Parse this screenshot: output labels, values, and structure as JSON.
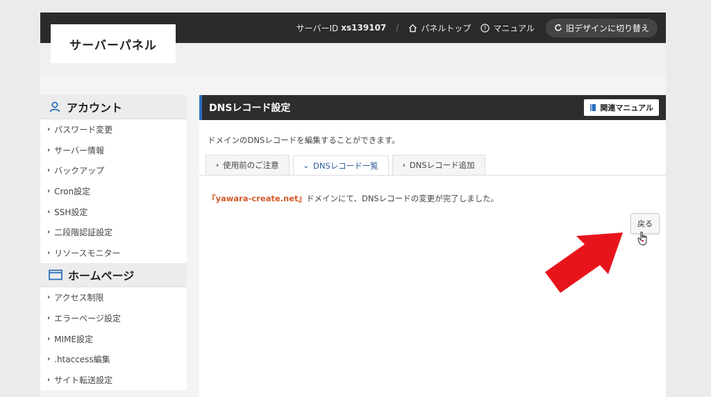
{
  "header": {
    "logo": "サーバーパネル",
    "server_id_label": "サーバーID",
    "server_id": "xs139107",
    "separator": "/",
    "panel_top": "パネルトップ",
    "manual": "マニュアル",
    "old_design": "旧デザインに切り替え"
  },
  "sidebar": {
    "sections": [
      {
        "title": "アカウント",
        "icon": "user-icon",
        "items": [
          "パスワード変更",
          "サーバー情報",
          "バックアップ",
          "Cron設定",
          "SSH設定",
          "二段階認証設定",
          "リソースモニター"
        ]
      },
      {
        "title": "ホームページ",
        "icon": "window-icon",
        "items": [
          "アクセス制限",
          "エラーページ設定",
          "MIME設定",
          ".htaccess編集",
          "サイト転送設定"
        ]
      }
    ]
  },
  "main": {
    "title": "DNSレコード設定",
    "related_manual": "関連マニュアル",
    "description": "ドメインのDNSレコードを編集することができます。",
    "tabs": [
      {
        "label": "使用前のご注意",
        "active": false
      },
      {
        "label": "DNSレコード一覧",
        "active": true
      },
      {
        "label": "DNSレコード追加",
        "active": false
      }
    ],
    "message_open": "『",
    "message_domain": "yawara-create.net",
    "message_close": "』",
    "message_rest": "ドメインにて、DNSレコードの変更が完了しました。",
    "back_button": "戻る"
  },
  "colors": {
    "topbar": "#2b2b2b",
    "accent_blue": "#2a6fbd",
    "domain_text": "#d55a2a",
    "arrow_red": "#e8141b"
  }
}
